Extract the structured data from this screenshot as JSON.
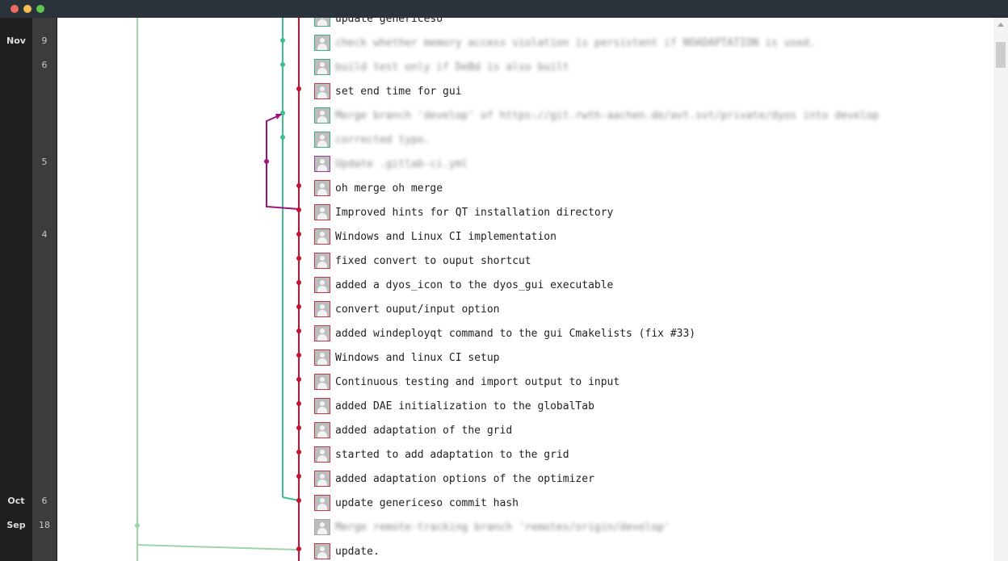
{
  "window": {
    "controls": [
      "close",
      "minimize",
      "maximize"
    ]
  },
  "colors": {
    "develop_branch": "#c41230",
    "feature_branch": "#3dbf94",
    "merge_branch": "#a0107a",
    "old_branch": "#9fd3a8"
  },
  "dates": {
    "months": [
      "Nov",
      "Oct",
      "Sep"
    ],
    "days": [
      "9",
      "6",
      "5",
      "4",
      "6",
      "18"
    ]
  },
  "commits": [
    {
      "message": "update genericeso",
      "avatar": "green",
      "blurred": false
    },
    {
      "message": "check whether memory access violation is persistent if NOADAPTATION is used.",
      "avatar": "green",
      "blurred": true
    },
    {
      "message": "build test only if DeBd is also built",
      "avatar": "green",
      "blurred": true
    },
    {
      "message": "set end time for gui",
      "avatar": "red",
      "blurred": false
    },
    {
      "message": "Merge branch 'develop' of https://git.rwth-aachen.de/avt.svt/private/dyos into develop",
      "avatar": "green",
      "blurred": true
    },
    {
      "message": "corrected typo.",
      "avatar": "green",
      "blurred": true
    },
    {
      "message": "Update .gitlab-ci.yml",
      "avatar": "purple",
      "blurred": true
    },
    {
      "message": "oh merge oh merge",
      "avatar": "red",
      "blurred": false
    },
    {
      "message": "Improved hints for QT installation directory",
      "avatar": "red",
      "blurred": false
    },
    {
      "message": "Windows and Linux CI implementation",
      "avatar": "red",
      "blurred": false
    },
    {
      "message": "fixed convert to ouput shortcut",
      "avatar": "red",
      "blurred": false
    },
    {
      "message": "added a dyos_icon to the dyos_gui executable",
      "avatar": "red",
      "blurred": false
    },
    {
      "message": "convert ouput/input option",
      "avatar": "red",
      "blurred": false
    },
    {
      "message": "added windeployqt command to the gui Cmakelists (fix #33)",
      "avatar": "red",
      "blurred": false
    },
    {
      "message": "Windows and linux CI setup",
      "avatar": "red",
      "blurred": false
    },
    {
      "message": "Continuous testing and import output to input",
      "avatar": "red",
      "blurred": false
    },
    {
      "message": "added DAE initialization to the globalTab",
      "avatar": "red",
      "blurred": false
    },
    {
      "message": "added adaptation of the grid",
      "avatar": "red",
      "blurred": false
    },
    {
      "message": "started to add adaptation to the grid",
      "avatar": "red",
      "blurred": false
    },
    {
      "message": "added adaptation options of the optimizer",
      "avatar": "red",
      "blurred": false
    },
    {
      "message": "update genericeso commit hash",
      "avatar": "red",
      "blurred": false
    },
    {
      "message": "Merge remote-tracking branch 'remotes/origin/develop'",
      "avatar": "gray",
      "blurred": true
    },
    {
      "message": "update.",
      "avatar": "red",
      "blurred": false
    }
  ]
}
